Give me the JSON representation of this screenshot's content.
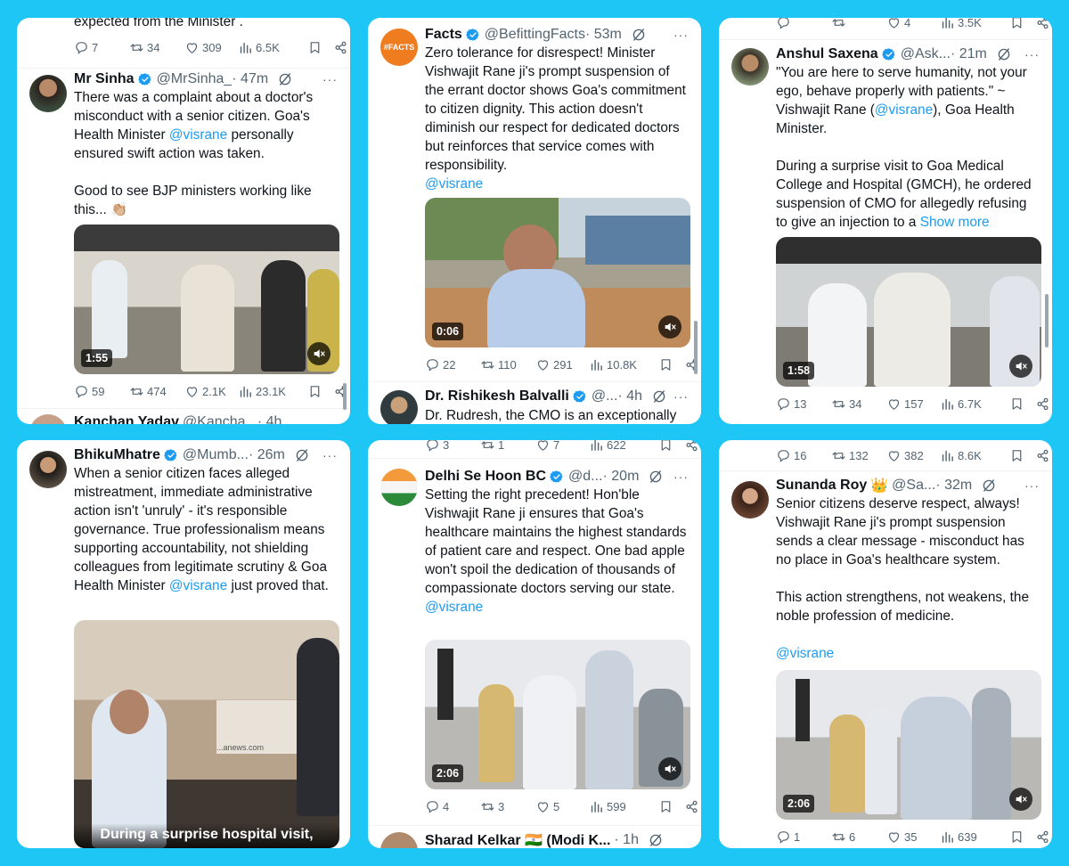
{
  "texts": {
    "c1_top_tail": "expected from the Minister .",
    "c1t_name": "Mr Sinha",
    "c1t_handle": "@MrSinha_",
    "c1t_time": "· 47m",
    "c1t_p1a": "There was a complaint about a doctor's misconduct with a senior citizen. Goa's Health Minister ",
    "c1t_p1b": " personally ensured swift action was taken.",
    "c1t_p2": "Good to see BJP ministers working like this... 👏🏼",
    "c1t_dur": "1:55",
    "c1n_name": "Kanchan Yadav",
    "c1n_handle": "@Kancha...",
    "c1n_time": "· 4h",
    "c2t_name": "Facts",
    "c2t_handle": "@BefittingFacts",
    "c2t_time": "· 53m",
    "c2t_p1": "Zero tolerance for disrespect! Minister Vishwajit Rane ji's prompt suspension of the errant doctor shows Goa's commitment to citizen dignity. This action doesn't diminish our respect for dedicated doctors but reinforces that service comes with responsibility.",
    "c2t_dur": "0:06",
    "c2n_name": "Dr. Rishikesh Balvalli",
    "c2n_handle": "@...",
    "c2n_time": "· 4h",
    "c2n_text": "Dr. Rudresh, the CMO is an exceptionally",
    "c3t_name": "Anshul Saxena",
    "c3t_handle": "@Ask...",
    "c3t_time": "· 21m",
    "c3t_p1a": "\"You are here to serve humanity, not your ego, behave properly with patients.\" ~ Vishwajit Rane (",
    "c3t_p1b": "), Goa Health Minister.",
    "c3t_p2": "During a surprise visit to Goa Medical College and Hospital (GMCH), he ordered suspension of CMO for allegedly refusing to give an injection to a ",
    "c3t_showmore": "Show more",
    "c3t_dur": "1:58",
    "c4t_name": "BhikuMhatre",
    "c4t_handle": "@Mumb...",
    "c4t_time": "· 26m",
    "c4t_p1a": "When a senior citizen faces alleged mistreatment, immediate administrative action isn't 'unruly' - it's responsible governance. True professionalism means supporting accountability, not shielding colleagues from legitimate scrutiny & Goa Health Minister ",
    "c4t_p1b": " just proved that.",
    "c4t_caption": "During a surprise hospital visit,",
    "c4t_watermark": "...anews.com",
    "c5t_name": "Delhi Se Hoon BC",
    "c5t_handle": "@d...",
    "c5t_time": "· 20m",
    "c5t_p1": "Setting the right precedent! Hon'ble Vishwajit Rane ji ensures that Goa's healthcare maintains the highest standards of patient care and respect. One bad apple won't spoil the dedication of thousands of compassionate doctors serving our state.",
    "c5t_dur": "2:06",
    "c5n_name": "Sharad Kelkar 🇮🇳 (Modi K...",
    "c5n_time": "· 1h",
    "c6t_name": "Sunanda Roy",
    "c6t_crown": "👑",
    "c6t_handle": "@Sa...",
    "c6t_time": "· 32m",
    "c6t_p1": "Senior citizens deserve respect, always! Vishwajit Rane ji's prompt suspension sends a clear message - misconduct has no place in Goa's healthcare system.",
    "c6t_p2": "This action strengthens, not weakens, the noble profession of medicine.",
    "c6t_dur": "2:06",
    "mention": "@visrane",
    "more": "···"
  },
  "stats": {
    "c1_top": [
      "7",
      "34",
      "309",
      "6.5K"
    ],
    "c1_main": [
      "59",
      "474",
      "2.1K",
      "23.1K"
    ],
    "c2_main": [
      "22",
      "110",
      "291",
      "10.8K"
    ],
    "c3_top": [
      "",
      "",
      "4",
      "3.5K"
    ],
    "c3_main": [
      "13",
      "34",
      "157",
      "6.7K"
    ],
    "c5_top": [
      "3",
      "1",
      "7",
      "622"
    ],
    "c5_main": [
      "4",
      "3",
      "5",
      "599"
    ],
    "c6_top": [
      "16",
      "132",
      "382",
      "8.6K"
    ],
    "c6_main": [
      "1",
      "6",
      "35",
      "639"
    ]
  },
  "icons": [
    "reply-icon",
    "retweet-icon",
    "like-icon",
    "views-icon",
    "bookmark-icon",
    "share-icon",
    "verified-icon",
    "grok-icon",
    "mute-icon"
  ],
  "colors": {
    "background": "#1ec6f5",
    "link": "#1d9bf0",
    "verified": "#1d9bf0",
    "muted": "#536471"
  }
}
